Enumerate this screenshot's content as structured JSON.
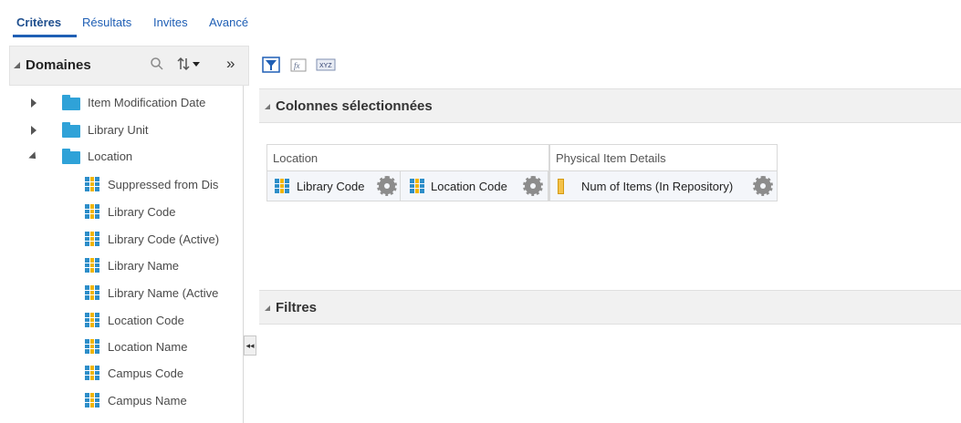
{
  "tabs": [
    "Critères",
    "Résultats",
    "Invites",
    "Avancé"
  ],
  "left_panel": {
    "title": "Domaines",
    "search_icon": "search-icon",
    "sort_icon": "sort-icon",
    "expand_icon": "double-chevron-right-icon"
  },
  "tree": [
    {
      "type": "folder",
      "label": "Item Modification Date",
      "expanded": false
    },
    {
      "type": "folder",
      "label": "Library Unit",
      "expanded": false
    },
    {
      "type": "folder",
      "label": "Location",
      "expanded": true
    },
    {
      "type": "column",
      "label": "Suppressed from Dis"
    },
    {
      "type": "column",
      "label": "Library Code"
    },
    {
      "type": "column",
      "label": "Library Code (Active)"
    },
    {
      "type": "column",
      "label": "Library Name"
    },
    {
      "type": "column",
      "label": "Library Name (Active"
    },
    {
      "type": "column",
      "label": "Location Code"
    },
    {
      "type": "column",
      "label": "Location Name"
    },
    {
      "type": "column",
      "label": "Campus Code"
    },
    {
      "type": "column",
      "label": "Campus Name"
    }
  ],
  "toolbar": {
    "icons": [
      "filter-icon",
      "edit-formula-icon",
      "xyz-icon"
    ],
    "xyz_label": "XYZ"
  },
  "sections": {
    "selected_columns": "Colonnes sélectionnées",
    "filters": "Filtres"
  },
  "column_groups": [
    {
      "title": "Location",
      "columns": [
        "Library Code",
        "Location Code"
      ]
    },
    {
      "title": "Physical Item Details",
      "columns": [
        "Num of Items (In Repository)"
      ]
    }
  ],
  "collapse_handle": "◂◂",
  "colors": {
    "accent": "#1f5fb5",
    "folder": "#2fa2d8",
    "header_bg": "#f1f1f1"
  }
}
